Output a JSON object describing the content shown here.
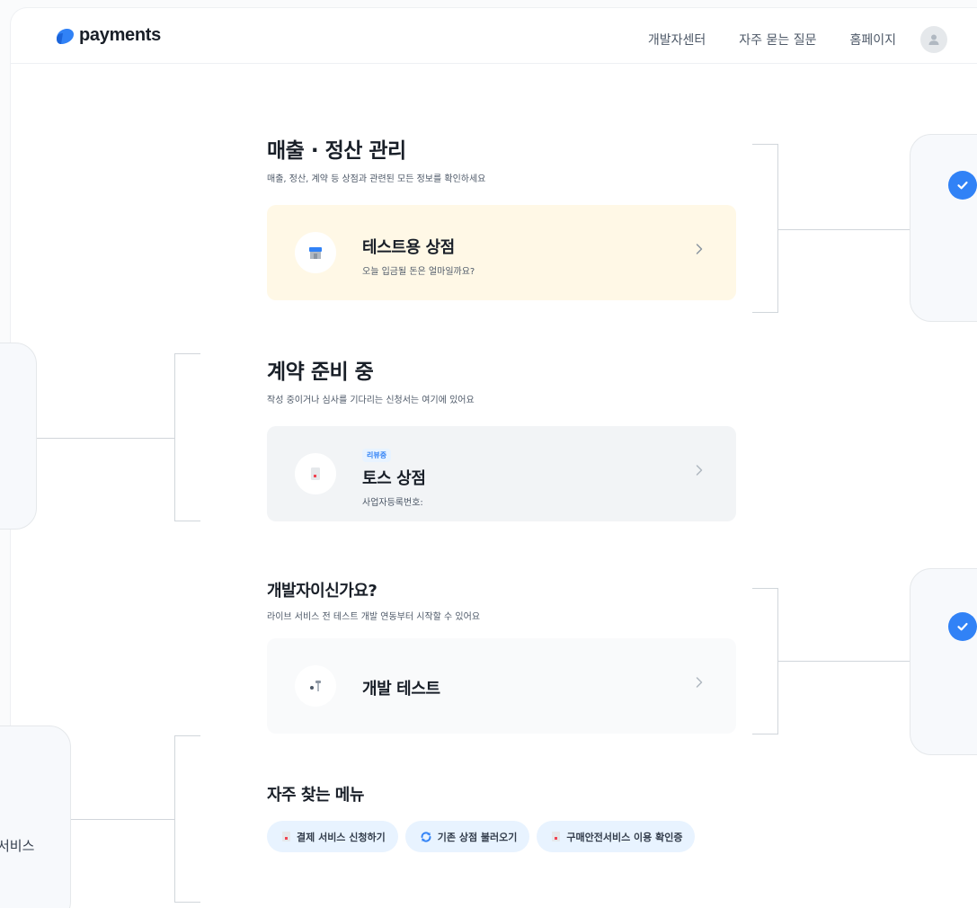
{
  "header": {
    "logo_text": "payments",
    "nav": [
      "개발자센터",
      "자주 묻는 질문",
      "홈페이지"
    ]
  },
  "sales": {
    "title": "매출 · 정산 관리",
    "subtitle": "매출, 정산, 계약 등 상점과 관련된 모든 정보를 확인하세요",
    "card": {
      "name": "테스트용 상점",
      "desc": "오늘 입금될 돈은 얼마일까요?"
    }
  },
  "contract": {
    "title": "계약 준비 중",
    "subtitle": "작성 중이거나 심사를 기다리는 신청서는 여기에 있어요",
    "card": {
      "badge": "리뷰중",
      "name": "토스 상점",
      "desc": "사업자등록번호:"
    }
  },
  "developer": {
    "title": "개발자이신가요?",
    "subtitle": "라이브 서비스 전 테스트 개발 연동부터 시작할 수 있어요",
    "card": {
      "name": "개발 테스트"
    }
  },
  "menu": {
    "title": "자주 찾는 메뉴",
    "chips": [
      "결제 서비스 신청하기",
      "기존 상점 불러오기",
      "구매안전서비스 이용 확인증"
    ]
  },
  "side_panel_text": "서비스",
  "colors": {
    "accent": "#3182f6",
    "card_highlight": "#fff8e6",
    "card_gray": "#f2f4f6"
  }
}
